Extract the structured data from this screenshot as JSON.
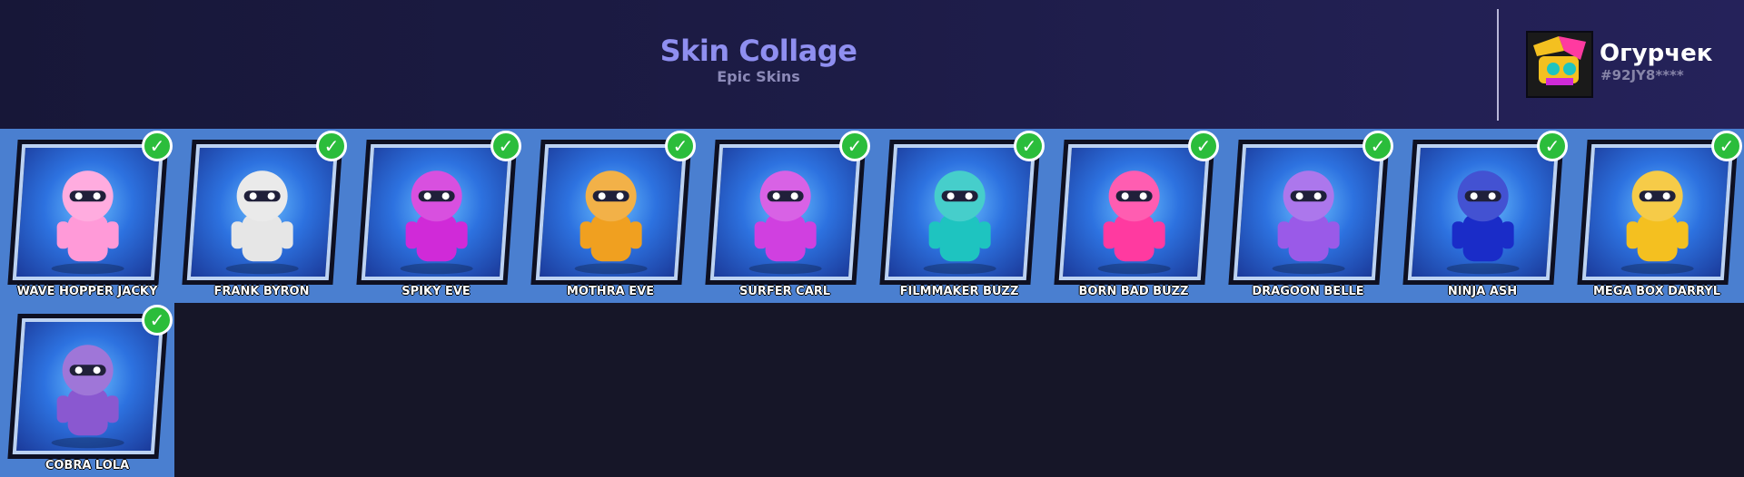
{
  "header": {
    "title": "Skin Collage",
    "subtitle": "Epic Skins"
  },
  "player": {
    "name": "Огурчек",
    "tag": "#92JY8****"
  },
  "skins": [
    {
      "name": "WAVE HOPPER JACKY",
      "owned": true,
      "accent": "#ff9ad8"
    },
    {
      "name": "FRANK BYRON",
      "owned": true,
      "accent": "#e6e6e6"
    },
    {
      "name": "SPIKY EVE",
      "owned": true,
      "accent": "#d02ad8"
    },
    {
      "name": "MOTHRA EVE",
      "owned": true,
      "accent": "#f0a020"
    },
    {
      "name": "SURFER CARL",
      "owned": true,
      "accent": "#d040e0"
    },
    {
      "name": "FILMMAKER BUZZ",
      "owned": true,
      "accent": "#1ec4c0"
    },
    {
      "name": "BORN BAD BUZZ",
      "owned": true,
      "accent": "#ff3aa0"
    },
    {
      "name": "DRAGOON BELLE",
      "owned": true,
      "accent": "#9a5ae8"
    },
    {
      "name": "NINJA ASH",
      "owned": true,
      "accent": "#1a2cc8"
    },
    {
      "name": "MEGA BOX DARRYL",
      "owned": true,
      "accent": "#f4c020"
    },
    {
      "name": "COBRA LOLA",
      "owned": true,
      "accent": "#8a58d0"
    }
  ],
  "icons": {
    "owned_check": "✓"
  }
}
